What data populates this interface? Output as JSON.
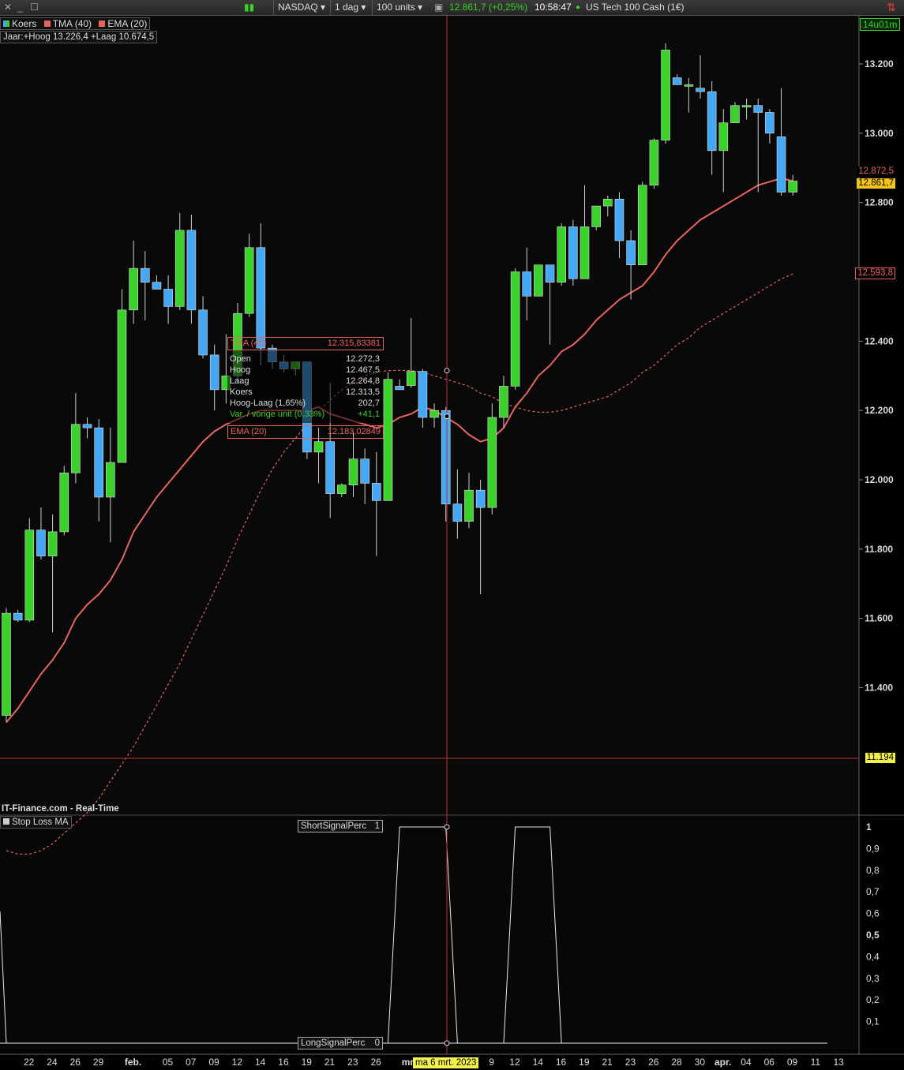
{
  "toolbar": {
    "market": "NASDAQ",
    "period": "1 dag",
    "units": "100 units",
    "price": "12.861,7 (+0,25%)",
    "time": "10:58:47",
    "instrument": "US Tech 100 Cash (1€)"
  },
  "legend": {
    "series": [
      {
        "label": "Koers",
        "color": "#3cc2ff"
      },
      {
        "label": "TMA (40)",
        "color": "#f07070"
      },
      {
        "label": "EMA (20)",
        "color": "#f07070"
      }
    ],
    "year_range": "Jaar:+Hoog 13.226,4 +Laag 10.674,5",
    "countdown": "14u01m"
  },
  "tooltip": {
    "tma": {
      "label": "TMA (40)",
      "value": "12.315,83381"
    },
    "ema": {
      "label": "EMA (20)",
      "value": "12.183,02849"
    },
    "rows": [
      {
        "k": "Open",
        "v": "12.272,3"
      },
      {
        "k": "Hoog",
        "v": "12.467,5"
      },
      {
        "k": "Laag",
        "v": "12.264,8"
      },
      {
        "k": "Koers",
        "v": "12.313,5"
      },
      {
        "k": "Hoog-Laag (1,65%)",
        "v": "202,7"
      },
      {
        "k": "Var. / vorige unit (0,33%)",
        "v": "+41,1"
      }
    ]
  },
  "price_tags": {
    "tma": "12.872,5",
    "last": "12.861,7",
    "ema": "12.593,8",
    "cursor": "11.194"
  },
  "watermark": "IT-Finance.com - Real-Time",
  "indicator": {
    "name": "Stop Loss MA",
    "short_label": "ShortSignalPerc",
    "short_value": "1",
    "long_label": "LongSignalPerc",
    "long_value": "0"
  },
  "cursor_date": "ma 6 mrt. 2023",
  "x_ticks": [
    "22",
    "24",
    "26",
    "29",
    "feb.",
    "05",
    "07",
    "09",
    "12",
    "14",
    "16",
    "19",
    "21",
    "23",
    "26",
    "mrt.",
    "9",
    "12",
    "14",
    "16",
    "19",
    "21",
    "23",
    "26",
    "28",
    "30",
    "apr.",
    "04",
    "06",
    "09",
    "11",
    "13"
  ],
  "colors": {
    "up": "#3ad12a",
    "down": "#44a8f5",
    "ma": "#e8645e",
    "grid": "#222"
  },
  "chart_data": {
    "type": "candlestick",
    "y_ticks": [
      "13.200",
      "13.000",
      "12.800",
      "12.400",
      "12.200",
      "12.000",
      "11.800",
      "11.600",
      "11.400"
    ],
    "ylim": [
      11120,
      13340
    ],
    "candles": [
      {
        "o": 11320,
        "h": 11630,
        "l": 11300,
        "c": 11615
      },
      {
        "o": 11615,
        "h": 11625,
        "l": 11590,
        "c": 11595
      },
      {
        "o": 11595,
        "h": 11890,
        "l": 11590,
        "c": 11855
      },
      {
        "o": 11855,
        "h": 11920,
        "l": 11770,
        "c": 11780
      },
      {
        "o": 11780,
        "h": 11900,
        "l": 11560,
        "c": 11850
      },
      {
        "o": 11850,
        "h": 12040,
        "l": 11840,
        "c": 12020
      },
      {
        "o": 12020,
        "h": 12250,
        "l": 11990,
        "c": 12160
      },
      {
        "o": 12160,
        "h": 12180,
        "l": 12120,
        "c": 12150
      },
      {
        "o": 12150,
        "h": 12175,
        "l": 11880,
        "c": 11950
      },
      {
        "o": 11950,
        "h": 12150,
        "l": 11820,
        "c": 12050
      },
      {
        "o": 12050,
        "h": 12550,
        "l": 12050,
        "c": 12490
      },
      {
        "o": 12490,
        "h": 12690,
        "l": 12450,
        "c": 12610
      },
      {
        "o": 12610,
        "h": 12660,
        "l": 12460,
        "c": 12570
      },
      {
        "o": 12570,
        "h": 12590,
        "l": 12550,
        "c": 12550
      },
      {
        "o": 12550,
        "h": 12590,
        "l": 12450,
        "c": 12500
      },
      {
        "o": 12500,
        "h": 12770,
        "l": 12490,
        "c": 12720
      },
      {
        "o": 12720,
        "h": 12765,
        "l": 12450,
        "c": 12490
      },
      {
        "o": 12490,
        "h": 12530,
        "l": 12350,
        "c": 12360
      },
      {
        "o": 12360,
        "h": 12390,
        "l": 12200,
        "c": 12260
      },
      {
        "o": 12260,
        "h": 12420,
        "l": 12220,
        "c": 12300
      },
      {
        "o": 12300,
        "h": 12510,
        "l": 12280,
        "c": 12480
      },
      {
        "o": 12480,
        "h": 12710,
        "l": 12470,
        "c": 12670
      },
      {
        "o": 12670,
        "h": 12740,
        "l": 12330,
        "c": 12380
      },
      {
        "o": 12380,
        "h": 12390,
        "l": 12320,
        "c": 12340
      },
      {
        "o": 12340,
        "h": 12360,
        "l": 12310,
        "c": 12320
      },
      {
        "o": 12320,
        "h": 12340,
        "l": 12300,
        "c": 12340
      },
      {
        "o": 12340,
        "h": 12340,
        "l": 12060,
        "c": 12080
      },
      {
        "o": 12080,
        "h": 12150,
        "l": 11990,
        "c": 12110
      },
      {
        "o": 12110,
        "h": 12280,
        "l": 11890,
        "c": 11960
      },
      {
        "o": 11960,
        "h": 11990,
        "l": 11950,
        "c": 11985
      },
      {
        "o": 11985,
        "h": 12140,
        "l": 11950,
        "c": 12060
      },
      {
        "o": 12060,
        "h": 12090,
        "l": 11930,
        "c": 11990
      },
      {
        "o": 11990,
        "h": 12080,
        "l": 11780,
        "c": 11940
      },
      {
        "o": 11940,
        "h": 12310,
        "l": 11940,
        "c": 12290
      },
      {
        "o": 12270,
        "h": 12290,
        "l": 12260,
        "c": 12260
      },
      {
        "o": 12272,
        "h": 12467,
        "l": 12265,
        "c": 12313
      },
      {
        "o": 12313,
        "h": 12320,
        "l": 12150,
        "c": 12180
      },
      {
        "o": 12180,
        "h": 12220,
        "l": 12150,
        "c": 12200
      },
      {
        "o": 12200,
        "h": 12210,
        "l": 11880,
        "c": 11930
      },
      {
        "o": 11930,
        "h": 12030,
        "l": 11830,
        "c": 11880
      },
      {
        "o": 11880,
        "h": 12020,
        "l": 11860,
        "c": 11970
      },
      {
        "o": 11970,
        "h": 12000,
        "l": 11670,
        "c": 11920
      },
      {
        "o": 11920,
        "h": 12220,
        "l": 11900,
        "c": 12180
      },
      {
        "o": 12180,
        "h": 12300,
        "l": 12150,
        "c": 12270
      },
      {
        "o": 12270,
        "h": 12610,
        "l": 12260,
        "c": 12600
      },
      {
        "o": 12600,
        "h": 12670,
        "l": 12460,
        "c": 12530
      },
      {
        "o": 12530,
        "h": 12620,
        "l": 12530,
        "c": 12620
      },
      {
        "o": 12620,
        "h": 12610,
        "l": 12390,
        "c": 12570
      },
      {
        "o": 12570,
        "h": 12740,
        "l": 12560,
        "c": 12730
      },
      {
        "o": 12730,
        "h": 12750,
        "l": 12560,
        "c": 12580
      },
      {
        "o": 12580,
        "h": 12850,
        "l": 12580,
        "c": 12730
      },
      {
        "o": 12730,
        "h": 12790,
        "l": 12720,
        "c": 12790
      },
      {
        "o": 12790,
        "h": 12820,
        "l": 12760,
        "c": 12810
      },
      {
        "o": 12810,
        "h": 12830,
        "l": 12640,
        "c": 12690
      },
      {
        "o": 12690,
        "h": 12720,
        "l": 12520,
        "c": 12620
      },
      {
        "o": 12620,
        "h": 12860,
        "l": 12620,
        "c": 12850
      },
      {
        "o": 12850,
        "h": 12985,
        "l": 12840,
        "c": 12980
      },
      {
        "o": 12980,
        "h": 13260,
        "l": 12970,
        "c": 13240
      },
      {
        "o": 13160,
        "h": 13170,
        "l": 13140,
        "c": 13140
      },
      {
        "o": 13140,
        "h": 13160,
        "l": 13060,
        "c": 13140
      },
      {
        "o": 13130,
        "h": 13225,
        "l": 13100,
        "c": 13120
      },
      {
        "o": 13120,
        "h": 13150,
        "l": 12880,
        "c": 12950
      },
      {
        "o": 12950,
        "h": 13070,
        "l": 12830,
        "c": 13030
      },
      {
        "o": 13030,
        "h": 13090,
        "l": 13030,
        "c": 13080
      },
      {
        "o": 13080,
        "h": 13100,
        "l": 13040,
        "c": 13080
      },
      {
        "o": 13080,
        "h": 13100,
        "l": 12830,
        "c": 13060
      },
      {
        "o": 13060,
        "h": 13070,
        "l": 12970,
        "c": 13000
      },
      {
        "o": 12990,
        "h": 13130,
        "l": 12820,
        "c": 12830
      },
      {
        "o": 12830,
        "h": 12880,
        "l": 12820,
        "c": 12862
      }
    ],
    "ema20": [
      11300,
      11340,
      11390,
      11440,
      11480,
      11530,
      11600,
      11640,
      11670,
      11710,
      11770,
      11850,
      11900,
      11950,
      11990,
      12030,
      12070,
      12110,
      12140,
      12160,
      12175,
      12190,
      12200,
      12200,
      12200,
      12200,
      12200,
      12210,
      12190,
      12180,
      12170,
      12160,
      12150,
      12160,
      12180,
      12190,
      12210,
      12200,
      12180,
      12160,
      12130,
      12110,
      12120,
      12150,
      12210,
      12250,
      12300,
      12330,
      12370,
      12390,
      12420,
      12460,
      12490,
      12520,
      12540,
      12560,
      12600,
      12650,
      12690,
      12720,
      12750,
      12770,
      12790,
      12810,
      12830,
      12850,
      12860,
      12870,
      12862
    ],
    "tma40": [
      10930,
      10920,
      10920,
      10930,
      10950,
      10980,
      11010,
      11040,
      11080,
      11130,
      11180,
      11230,
      11290,
      11350,
      11410,
      11470,
      11540,
      11610,
      11680,
      11750,
      11830,
      11900,
      11970,
      12030,
      12080,
      12120,
      12160,
      12200,
      12230,
      12260,
      12280,
      12300,
      12310,
      12315,
      12316,
      12315,
      12310,
      12300,
      12290,
      12280,
      12270,
      12250,
      12240,
      12220,
      12210,
      12200,
      12195,
      12195,
      12200,
      12210,
      12220,
      12230,
      12240,
      12260,
      12280,
      12310,
      12330,
      12360,
      12390,
      12410,
      12440,
      12460,
      12480,
      12500,
      12520,
      12540,
      12560,
      12580,
      12594
    ],
    "short_signal": [
      0,
      0,
      0,
      0,
      0,
      0,
      0,
      0,
      0,
      0,
      0,
      0,
      0,
      0,
      0,
      0,
      0,
      0,
      0,
      0,
      0,
      0,
      0,
      0,
      0,
      0,
      0,
      0,
      0,
      0,
      0,
      0,
      0,
      0,
      1,
      1,
      1,
      1,
      1,
      0,
      0,
      0,
      0,
      0,
      1,
      1,
      1,
      1,
      0,
      0,
      0,
      0,
      0,
      0,
      0,
      0,
      0,
      0,
      0,
      0,
      0,
      0,
      0,
      0,
      0,
      0,
      0,
      0,
      0
    ]
  }
}
